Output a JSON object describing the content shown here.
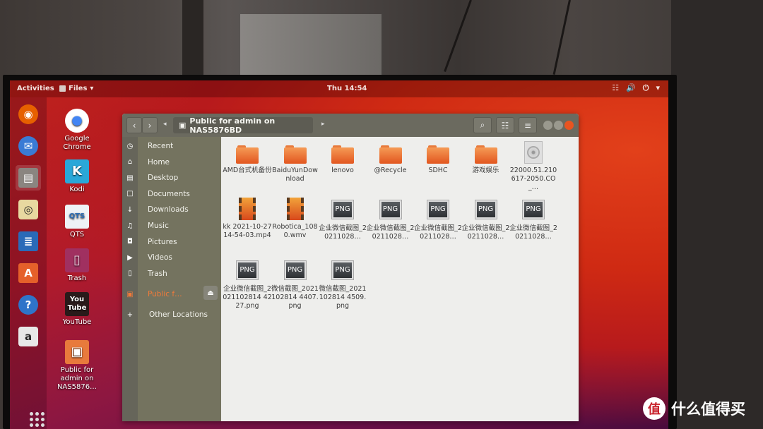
{
  "topbar": {
    "activities": "Activities",
    "app_menu": "Files",
    "clock": "Thu 14:54",
    "tray": {
      "network": "network-icon",
      "volume": "volume-icon",
      "power": "power-icon",
      "menu": "chevron-down-icon"
    }
  },
  "dock": [
    {
      "name": "firefox",
      "color": "#e66000",
      "glyph": "◉"
    },
    {
      "name": "thunderbird",
      "color": "#3a7bd5",
      "glyph": "✉"
    },
    {
      "name": "files",
      "color": "#8a8580",
      "glyph": "▤",
      "active": true
    },
    {
      "name": "rhythmbox",
      "color": "#e8d8a0",
      "glyph": "◎"
    },
    {
      "name": "libreoffice-writer",
      "color": "#2a6ab8",
      "glyph": "≣"
    },
    {
      "name": "ubuntu-software",
      "color": "#e5602a",
      "glyph": "A"
    },
    {
      "name": "help",
      "color": "#2f74c9",
      "glyph": "?"
    },
    {
      "name": "amazon",
      "color": "#e8e8e8",
      "glyph": "a"
    }
  ],
  "desktop_icons": [
    {
      "label": "Google Chrome",
      "glyph": "●",
      "bg": "#ffffff",
      "fg": "#4285f4"
    },
    {
      "label": "Kodi",
      "glyph": "K",
      "bg": "#2aa7d8",
      "fg": "#ffffff"
    },
    {
      "label": "QTS",
      "glyph": "QTS",
      "bg": "#eef2f6",
      "fg": "#2d6fb7"
    },
    {
      "label": "Trash",
      "glyph": "▯",
      "bg": "#a03060",
      "fg": "#f0d0e0"
    },
    {
      "label": "YouTube",
      "glyph": "You Tube",
      "bg": "#2a1a1a",
      "fg": "#ffffff"
    },
    {
      "label": "Public for admin on NAS5876…",
      "glyph": "▣",
      "bg": "#e87a3c",
      "fg": "#ffffff"
    }
  ],
  "window": {
    "path": "Public for admin on NAS5876BD",
    "buttons": {
      "back": "‹",
      "forward": "›",
      "path_left": "◂",
      "path_right": "▸",
      "search": "⌕",
      "view": "☷",
      "menu": "≡"
    },
    "sidebar": [
      {
        "label": "Recent",
        "icon": "◷"
      },
      {
        "label": "Home",
        "icon": "⌂"
      },
      {
        "label": "Desktop",
        "icon": "▤"
      },
      {
        "label": "Documents",
        "icon": "□"
      },
      {
        "label": "Downloads",
        "icon": "↓"
      },
      {
        "label": "Music",
        "icon": "♫"
      },
      {
        "label": "Pictures",
        "icon": "◘"
      },
      {
        "label": "Videos",
        "icon": "▶"
      },
      {
        "label": "Trash",
        "icon": "▯"
      }
    ],
    "network_location": "Public f…",
    "other_locations": "Other Locations",
    "files": [
      {
        "type": "folder",
        "name": "AMD台式机备份"
      },
      {
        "type": "folder",
        "name": "BaiduYunDownload"
      },
      {
        "type": "folder",
        "name": "lenovo"
      },
      {
        "type": "folder",
        "name": "@Recycle"
      },
      {
        "type": "folder",
        "name": "SDHC"
      },
      {
        "type": "folder",
        "name": "游戏娱乐"
      },
      {
        "type": "iso",
        "name": "22000.51.210617-2050.CO_…"
      },
      {
        "type": "video",
        "name": "kk 2021-10-27 14-54-03.mp4"
      },
      {
        "type": "video",
        "name": "Robotica_1080.wmv"
      },
      {
        "type": "png",
        "name": "企业微信截图_20211028…"
      },
      {
        "type": "png",
        "name": "企业微信截图_20211028…"
      },
      {
        "type": "png",
        "name": "企业微信截图_20211028…"
      },
      {
        "type": "png",
        "name": "企业微信截图_20211028…"
      },
      {
        "type": "png",
        "name": "企业微信截图_20211028…"
      },
      {
        "type": "png",
        "name": "企业微信截图_2021102814 4227.png"
      },
      {
        "type": "png",
        "name": "微信截图_2021102814 4407.png"
      },
      {
        "type": "png",
        "name": "微信截图_2021102814 4509.png"
      }
    ],
    "png_label": "PNG"
  },
  "watermark": {
    "logo": "值",
    "text": "什么值得买"
  }
}
